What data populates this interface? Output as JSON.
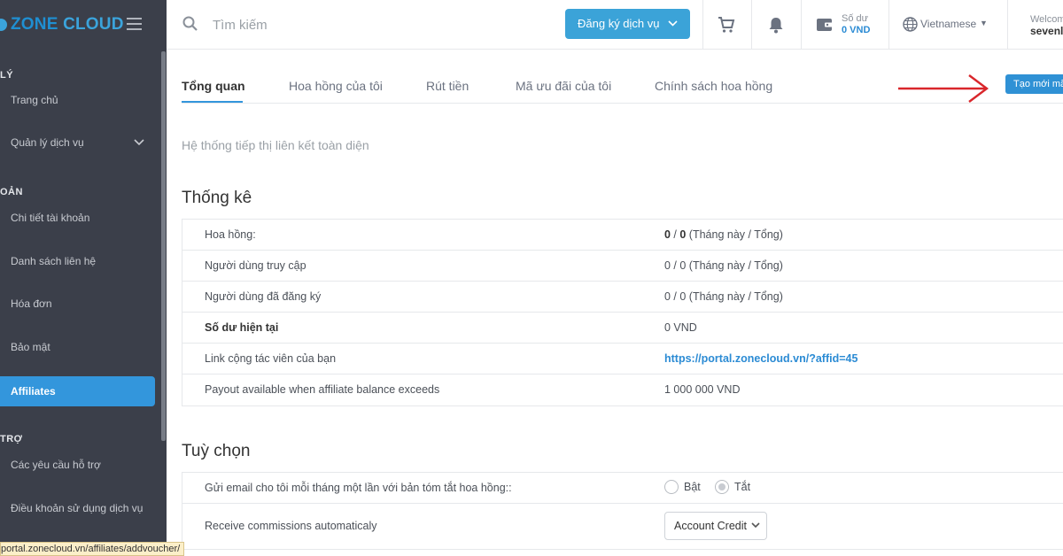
{
  "brand": {
    "zone": "ZONE",
    "cloud": "CLOUD"
  },
  "sidebar": {
    "section_manage": "LÝ",
    "items_manage": [
      {
        "label": "Trang chủ"
      },
      {
        "label": "Quản lý dịch vụ"
      }
    ],
    "section_account": "OẢN",
    "items_account": [
      {
        "label": "Chi tiết tài khoản"
      },
      {
        "label": "Danh sách liên hệ"
      },
      {
        "label": "Hóa đơn"
      },
      {
        "label": "Bảo mật"
      },
      {
        "label": "Affiliates"
      }
    ],
    "section_support": "TRỢ",
    "items_support": [
      {
        "label": "Các yêu cầu hỗ trợ"
      },
      {
        "label": "Điều khoản sử dụng dịch vụ"
      }
    ],
    "status_url": "portal.zonecloud.vn/affiliates/addvoucher/"
  },
  "topbar": {
    "search_placeholder": "Tìm kiếm",
    "register_label": "Đăng ký dịch vụ",
    "balance_label": "Số dư",
    "balance_value": "0 VND",
    "language": "Vietnamese",
    "welcome": "Welcome",
    "username": "sevenlu"
  },
  "tabs": [
    {
      "label": "Tổng quan"
    },
    {
      "label": "Hoa hồng của tôi"
    },
    {
      "label": "Rút tiền"
    },
    {
      "label": "Mã ưu đãi của tôi"
    },
    {
      "label": "Chính sách hoa hồng"
    }
  ],
  "create_button": "Tạo mới mã",
  "subtitle": "Hệ thống tiếp thị liên kết toàn diện",
  "stats": {
    "title": "Thống kê",
    "rows": [
      {
        "label": "Hoa hồng:",
        "v1": "0",
        "sep": " / ",
        "v2": "0",
        "suffix": " (Tháng này / Tổng)"
      },
      {
        "label": "Người dùng truy cập",
        "value": "0 / 0 (Tháng này / Tổng)"
      },
      {
        "label": "Người dùng đã đăng ký",
        "value": "0 / 0 (Tháng này / Tổng)"
      },
      {
        "label": "Số dư hiện tại",
        "value": "0 VND"
      },
      {
        "label": "Link cộng tác viên của bạn",
        "value": "https://portal.zonecloud.vn/?affid=45"
      },
      {
        "label": "Payout available when affiliate balance exceeds",
        "value": "1 000 000 VND"
      }
    ]
  },
  "options": {
    "title": "Tuỳ chọn",
    "email_label": "Gửi email cho tôi mỗi tháng một lần với bản tóm tắt hoa hồng::",
    "radio_on": "Bật",
    "radio_off": "Tắt",
    "auto_label": "Receive commissions automaticaly",
    "auto_select": "Account Credit"
  },
  "colors": {
    "sidebar_bg": "#3b3f4a",
    "accent": "#3396dc",
    "annotation_arrow": "#d9262b"
  }
}
